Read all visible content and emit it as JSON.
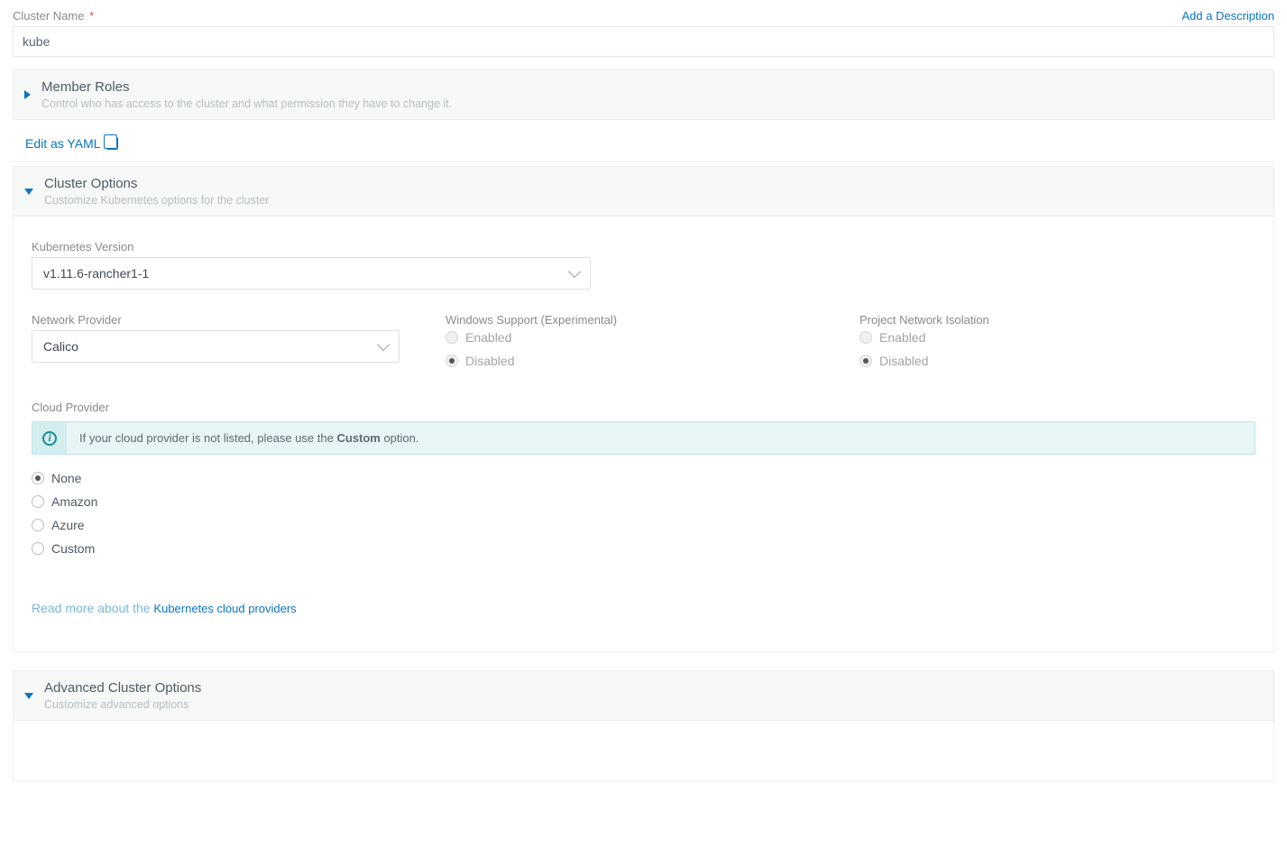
{
  "header": {
    "cluster_name_label": "Cluster Name",
    "required_mark": "*",
    "add_description": "Add a Description",
    "cluster_name_value": "kube"
  },
  "member_roles": {
    "title": "Member Roles",
    "subtitle": "Control who has access to the cluster and what permission they have to change it."
  },
  "edit_yaml": "Edit as YAML",
  "cluster_options": {
    "title": "Cluster Options",
    "subtitle": "Customize Kubernetes options for the cluster",
    "k8s_version_label": "Kubernetes Version",
    "k8s_version_value": "v1.11.6-rancher1-1",
    "network_provider_label": "Network Provider",
    "network_provider_value": "Calico",
    "windows_label": "Windows Support (Experimental)",
    "windows_enabled": "Enabled",
    "windows_disabled": "Disabled",
    "isolation_label": "Project Network Isolation",
    "isolation_enabled": "Enabled",
    "isolation_disabled": "Disabled",
    "cloud_provider_label": "Cloud Provider",
    "cloud_info_prefix": "If your cloud provider is not listed, please use the ",
    "cloud_info_bold": "Custom",
    "cloud_info_suffix": " option.",
    "cp_none": "None",
    "cp_amazon": "Amazon",
    "cp_azure": "Azure",
    "cp_custom": "Custom",
    "read_more_prefix": "Read more about the ",
    "read_more_link": "Kubernetes cloud providers"
  },
  "advanced": {
    "title": "Advanced Cluster Options",
    "subtitle": "Customize advanced options"
  }
}
